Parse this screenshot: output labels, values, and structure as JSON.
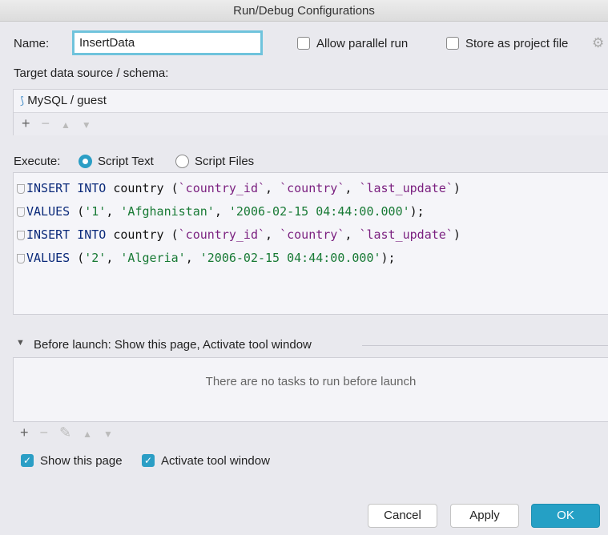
{
  "window": {
    "title": "Run/Debug Configurations"
  },
  "name": {
    "label": "Name:",
    "value": "InsertData"
  },
  "options": {
    "allow_parallel": {
      "label": "Allow parallel run",
      "checked": false
    },
    "store_project": {
      "label": "Store as project file",
      "checked": false
    }
  },
  "target": {
    "label": "Target data source / schema:",
    "item": "MySQL / guest",
    "icon": "mysql-dolphin-icon"
  },
  "execute": {
    "label": "Execute:",
    "options": [
      {
        "label": "Script Text",
        "selected": true
      },
      {
        "label": "Script Files",
        "selected": false
      }
    ]
  },
  "code": [
    [
      [
        "kw",
        "INSERT INTO "
      ],
      [
        "pl",
        "country ("
      ],
      [
        "id",
        "`country_id`"
      ],
      [
        "pl",
        ", "
      ],
      [
        "id",
        "`country`"
      ],
      [
        "pl",
        ", "
      ],
      [
        "id",
        "`last_update`"
      ],
      [
        "pl",
        ")"
      ]
    ],
    [
      [
        "kw",
        "VALUES "
      ],
      [
        "pl",
        "("
      ],
      [
        "str",
        "'1'"
      ],
      [
        "pl",
        ", "
      ],
      [
        "str",
        "'Afghanistan'"
      ],
      [
        "pl",
        ", "
      ],
      [
        "str",
        "'2006-02-15 04:44:00.000'"
      ],
      [
        "pl",
        ");"
      ]
    ],
    [
      [
        "kw",
        "INSERT INTO "
      ],
      [
        "pl",
        "country ("
      ],
      [
        "id",
        "`country_id`"
      ],
      [
        "pl",
        ", "
      ],
      [
        "id",
        "`country`"
      ],
      [
        "pl",
        ", "
      ],
      [
        "id",
        "`last_update`"
      ],
      [
        "pl",
        ")"
      ]
    ],
    [
      [
        "kw",
        "VALUES "
      ],
      [
        "pl",
        "("
      ],
      [
        "str",
        "'2'"
      ],
      [
        "pl",
        ", "
      ],
      [
        "str",
        "'Algeria'"
      ],
      [
        "pl",
        ", "
      ],
      [
        "str",
        "'2006-02-15 04:44:00.000'"
      ],
      [
        "pl",
        ");"
      ]
    ]
  ],
  "before_launch": {
    "title": "Before launch: Show this page, Activate tool window",
    "empty": "There are no tasks to run before launch"
  },
  "checks": {
    "show_page": {
      "label": "Show this page",
      "checked": true
    },
    "activate": {
      "label": "Activate tool window",
      "checked": true
    }
  },
  "buttons": {
    "cancel": "Cancel",
    "apply": "Apply",
    "ok": "OK"
  },
  "colors": {
    "accent": "#25a0c5",
    "focus": "#6fc3dc"
  }
}
